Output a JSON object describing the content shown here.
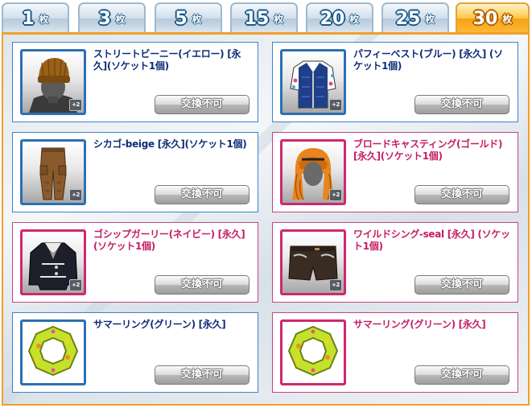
{
  "tabs": [
    {
      "num": "1",
      "unit": "枚"
    },
    {
      "num": "3",
      "unit": "枚"
    },
    {
      "num": "5",
      "unit": "枚"
    },
    {
      "num": "15",
      "unit": "枚"
    },
    {
      "num": "20",
      "unit": "枚"
    },
    {
      "num": "25",
      "unit": "枚"
    },
    {
      "num": "30",
      "unit": "枚",
      "active": true
    }
  ],
  "items": [
    {
      "name": "ストリートビーニー(イエロー) [永久](ソケット1個)",
      "badge": "+2",
      "button": "交換不可",
      "frame": "blue",
      "icon": "beanie-icon"
    },
    {
      "name": "パフィーベスト(ブルー) [永久] (ソケット1個)",
      "badge": "+2",
      "button": "交換不可",
      "frame": "blue",
      "icon": "vest-icon"
    },
    {
      "name": "シカゴ-beige [永久](ソケット1個)",
      "badge": "+2",
      "button": "交換不可",
      "frame": "blue",
      "icon": "pants-icon"
    },
    {
      "name": "ブロードキャスティング(ゴールド) [永久](ソケット1個)",
      "badge": "+2",
      "button": "交換不可",
      "frame": "pink",
      "icon": "hair-icon"
    },
    {
      "name": "ゴシップガーリー(ネイビー) [永久](ソケット1個)",
      "badge": "+2",
      "button": "交換不可",
      "frame": "pink",
      "icon": "jacket-icon"
    },
    {
      "name": "ワイルドシング-seal [永久] (ソケット1個)",
      "badge": "+2",
      "button": "交換不可",
      "frame": "pink",
      "icon": "shorts-icon"
    },
    {
      "name": "サマーリング(グリーン) [永久]",
      "badge": "",
      "button": "交換不可",
      "frame": "blue",
      "icon": "swim-ring-icon"
    },
    {
      "name": "サマーリング(グリーン) [永久]",
      "badge": "",
      "button": "交換不可",
      "frame": "pink",
      "icon": "swim-ring-icon"
    }
  ]
}
